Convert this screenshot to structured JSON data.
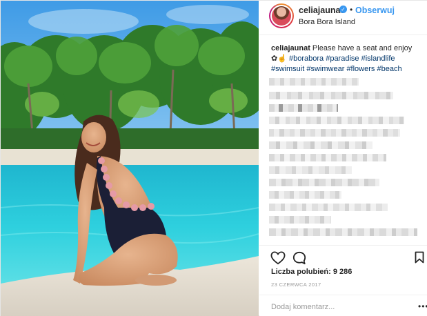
{
  "post": {
    "username": "celiajaunat",
    "follow_label": "Obserwuj",
    "separator": "•",
    "location": "Bora Bora Island",
    "verified_icon": "verified-badge-icon",
    "caption": {
      "username": "celiajaunat",
      "text": "Please have a seat and enjoy",
      "emoji": "✿☝",
      "hashtags": [
        "#borabora",
        "#paradise",
        "#islandlife",
        "#swimsuit",
        "#swimwear",
        "#flowers",
        "#beach"
      ]
    },
    "likes_label": "Liczba polubień: 9 286",
    "date": "23 czerwca 2017",
    "comment_placeholder": "Dodaj komentarz...",
    "more_label": "•••",
    "icons": {
      "like": "heart-icon",
      "comment": "comment-icon",
      "save": "bookmark-icon",
      "more": "more-options-icon"
    },
    "colors": {
      "link": "#3897f0",
      "hashtag": "#003569",
      "muted": "#999999",
      "text": "#262626"
    }
  }
}
